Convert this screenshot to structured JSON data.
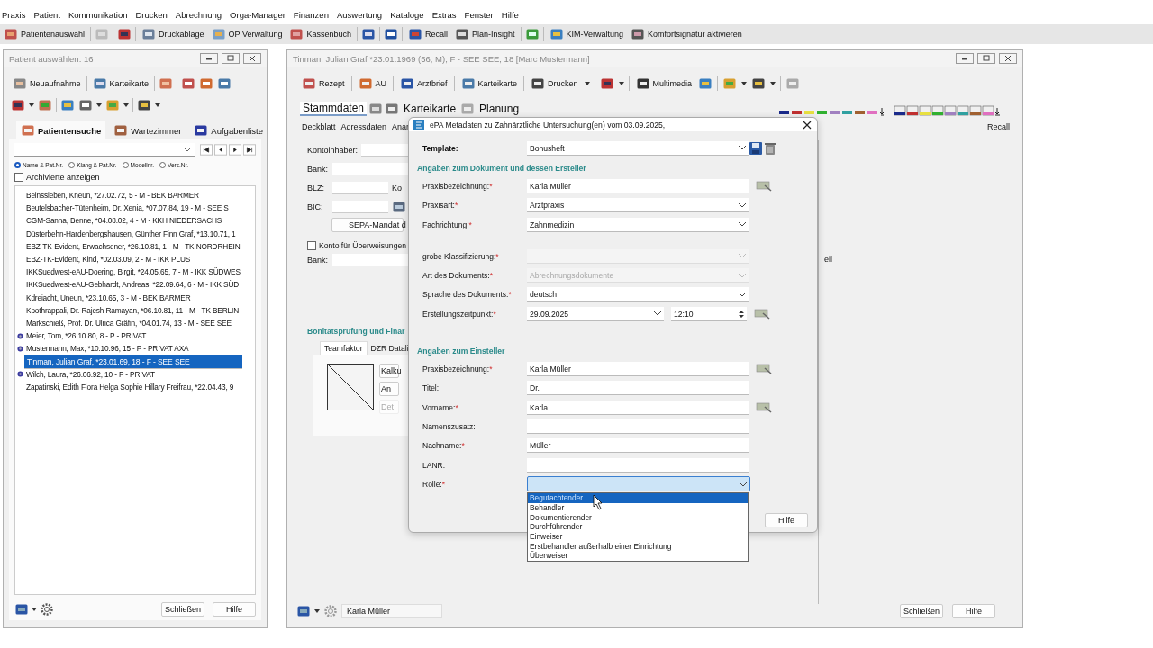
{
  "menu_bar": [
    {
      "label": "Praxis"
    },
    {
      "label": "Patient"
    },
    {
      "label": "Kommunikation"
    },
    {
      "label": "Drucken"
    },
    {
      "label": "Abrechnung"
    },
    {
      "label": "Orga-Manager"
    },
    {
      "label": "Finanzen"
    },
    {
      "label": "Auswertung"
    },
    {
      "label": "Kataloge"
    },
    {
      "label": "Extras"
    },
    {
      "label": "Fenster"
    },
    {
      "label": "Hilfe"
    }
  ],
  "main_toolbar": [
    {
      "label": "Patientenauswahl"
    },
    {
      "label": "Druckablage"
    },
    {
      "label": "OP Verwaltung"
    },
    {
      "label": "Kassenbuch"
    },
    {
      "label": "Recall"
    },
    {
      "label": "Plan-Insight"
    },
    {
      "label": "KIM-Verwaltung"
    },
    {
      "label": "Komfortsignatur aktivieren"
    }
  ],
  "patient_window": {
    "title": "Patient auswählen: 16",
    "toolbar": [
      {
        "label": "Neuaufnahme"
      },
      {
        "label": "Karteikarte"
      }
    ],
    "tabs": [
      {
        "label": "Patientensuche",
        "selected": true
      },
      {
        "label": "Wartezimmer",
        "selected": false
      },
      {
        "label": "Aufgabenliste",
        "selected": false
      }
    ],
    "search_modes": [
      {
        "label": "Name & Pat.Nr.",
        "selected": true
      },
      {
        "label": "Klang & Pat.Nr.",
        "selected": false
      },
      {
        "label": "Modellnr.",
        "selected": false
      },
      {
        "label": "Vers.Nr.",
        "selected": false
      }
    ],
    "show_archived": {
      "label": "Archivierte anzeigen",
      "checked": false
    },
    "patients": [
      {
        "text": "Beinssieben, Kneun, *27.02.72,  5 - M - BEK BARMER",
        "marked": false,
        "selected": false
      },
      {
        "text": "Beutelsbacher-Tütenheim, Dr. Xenia, *07.07.84,  19 - M - SEE S",
        "marked": false,
        "selected": false
      },
      {
        "text": "CGM-Sanna, Benne, *04.08.02,  4 - M - KKH NIEDERSACHS",
        "marked": false,
        "selected": false
      },
      {
        "text": "Düsterbehn-Hardenbergshausen, Günther Finn Graf, *13.10.71,  1",
        "marked": false,
        "selected": false
      },
      {
        "text": "EBZ-TK-Evident, Erwachsener, *26.10.81,  1 - M - TK NORDRHEIN",
        "marked": false,
        "selected": false
      },
      {
        "text": "EBZ-TK-Evident, Kind, *02.03.09,  2 - M - IKK PLUS",
        "marked": false,
        "selected": false
      },
      {
        "text": "IKKSuedwest-eAU-Doering, Birgit, *24.05.65,  7 - M - IKK SÜDWES",
        "marked": false,
        "selected": false
      },
      {
        "text": "IKKSuedwest-eAU-Gebhardt, Andreas, *22.09.64,  6 - M - IKK SÜD",
        "marked": false,
        "selected": false
      },
      {
        "text": "Kdreiacht, Uneun, *23.10.65,  3 - M - BEK BARMER",
        "marked": false,
        "selected": false
      },
      {
        "text": "Koothrappali, Dr. Rajesh Ramayan, *06.10.81,  11 - M - TK BERLIN",
        "marked": false,
        "selected": false
      },
      {
        "text": "Markschieß, Prof. Dr. Ulrica Gräfin, *04.01.74,  13 - M - SEE SEE",
        "marked": false,
        "selected": false
      },
      {
        "text": "Meier, Tom, *26.10.80,  8 - P - PRIVAT",
        "marked": true,
        "selected": false
      },
      {
        "text": "Mustermann, Max, *10.10.96,  15 - P - PRIVAT AXA",
        "marked": true,
        "selected": false
      },
      {
        "text": "Tinman, Julian Graf, *23.01.69,  18 - F - SEE SEE",
        "marked": false,
        "selected": true
      },
      {
        "text": "Wilch, Laura, *26.06.92,  10 - P - PRIVAT",
        "marked": true,
        "selected": false
      },
      {
        "text": "Zapatinski, Edith Flora Helga Sophie Hillary Freifrau, *22.04.43,  9",
        "marked": false,
        "selected": false
      }
    ],
    "buttons": [
      {
        "label": "Schließen"
      },
      {
        "label": "Hilfe"
      }
    ]
  },
  "record_window": {
    "title": "Tinman, Julian Graf  *23.01.1969 (56, M),  F - SEE SEE,  18 [Marc Mustermann]",
    "toolbar": [
      {
        "label": "Rezept"
      },
      {
        "label": "AU"
      },
      {
        "label": "Arztbrief"
      },
      {
        "label": "Karteikarte"
      },
      {
        "label": "Drucken"
      },
      {
        "label": "Multimedia"
      }
    ],
    "tabs": [
      {
        "label": "Stammdaten",
        "selected": true
      },
      {
        "label": "Karteikarte",
        "selected": false
      },
      {
        "label": "Planung",
        "selected": false
      }
    ],
    "subtabs": [
      {
        "label": "Deckblatt"
      },
      {
        "label": "Adressdaten"
      },
      {
        "label": "Anar"
      }
    ],
    "subtab_right": {
      "label": "Recall"
    },
    "bank_fields": [
      {
        "label": "Kontoinhaber:"
      },
      {
        "label": "Bank:"
      },
      {
        "label": "BLZ:",
        "extra": "Ko"
      },
      {
        "label": "BIC:"
      }
    ],
    "sepa_button": {
      "label": "SEPA-Mandat d"
    },
    "transfer_account": {
      "label": "Konto für Überweisungen",
      "checked": false
    },
    "bank2": {
      "label": "Bank:"
    },
    "credit_heading": "Bonitätsprüfung und Finar",
    "credit_tabs": [
      {
        "label": "Teamfaktor",
        "selected": true
      },
      {
        "label": "DZR Datali",
        "selected": false
      }
    ],
    "credit_buttons": [
      {
        "label": "Kalku",
        "disabled": false
      },
      {
        "label": "An",
        "disabled": false
      },
      {
        "label": "Det",
        "disabled": true
      }
    ],
    "side_label": "eil",
    "user_field": "Karla Müller",
    "buttons": [
      {
        "label": "Schließen"
      },
      {
        "label": "Hilfe"
      }
    ]
  },
  "dialog": {
    "title": "ePA Metadaten zu Zahnärztliche Untersuchung(en) vom 03.09.2025,",
    "template": {
      "label": "Template:",
      "value": "Bonusheft"
    },
    "sections": [
      {
        "heading": "Angaben zum Dokument und dessen Ersteller",
        "groups": [
          [
            {
              "label": "Praxisbezeichnung:",
              "required": "*",
              "kind": "text",
              "value": "Karla Müller",
              "picker": true
            },
            {
              "label": "Praxisart:",
              "required": "*",
              "kind": "select",
              "value": "Arztpraxis"
            },
            {
              "label": "Fachrichtung:",
              "required": "*",
              "kind": "select",
              "value": "Zahnmedizin"
            }
          ],
          [
            {
              "label": "grobe Klassifizierung:",
              "required": "*",
              "kind": "select",
              "disabled": true
            },
            {
              "label": "Art des Dokuments:",
              "required": "*",
              "kind": "select",
              "value": "Abrechnungsdokumente",
              "disabled": true
            },
            {
              "label": "Sprache des Dokuments:",
              "required": "*",
              "kind": "select",
              "value": "deutsch"
            },
            {
              "label": "Erstellungszeitpunkt:",
              "required": "*",
              "kind": "datetime",
              "value": "29.09.2025",
              "time": "12:10",
              "picker": true
            }
          ]
        ]
      },
      {
        "heading": "Angaben zum Einsteller",
        "groups": [
          [
            {
              "label": "Praxisbezeichnung:",
              "required": "*",
              "kind": "text",
              "value": "Karla Müller",
              "picker": true
            },
            {
              "label": "Titel:",
              "kind": "text",
              "value": "Dr."
            },
            {
              "label": "Vorname:",
              "required": "*",
              "kind": "text",
              "value": "Karla",
              "picker": true
            },
            {
              "label": "Namenszusatz:",
              "kind": "text"
            },
            {
              "label": "Nachname:",
              "required": "*",
              "kind": "text",
              "value": "Müller"
            },
            {
              "label": "LANR:",
              "kind": "text"
            },
            {
              "label": "Rolle:",
              "required": "*",
              "kind": "select",
              "open": true,
              "options": [
                {
                  "label": "Begutachtender",
                  "selected": true
                },
                {
                  "label": "Behandler",
                  "selected": false
                },
                {
                  "label": "Dokumentierender",
                  "selected": false
                },
                {
                  "label": "Durchführender",
                  "selected": false
                },
                {
                  "label": "Einweiser",
                  "selected": false
                },
                {
                  "label": "Erstbehandler außerhalb einer Einrichtung",
                  "selected": false
                },
                {
                  "label": "Überweiser",
                  "selected": false
                }
              ]
            }
          ]
        ]
      }
    ],
    "buttons": [
      {
        "label": "Hilfe"
      }
    ]
  }
}
